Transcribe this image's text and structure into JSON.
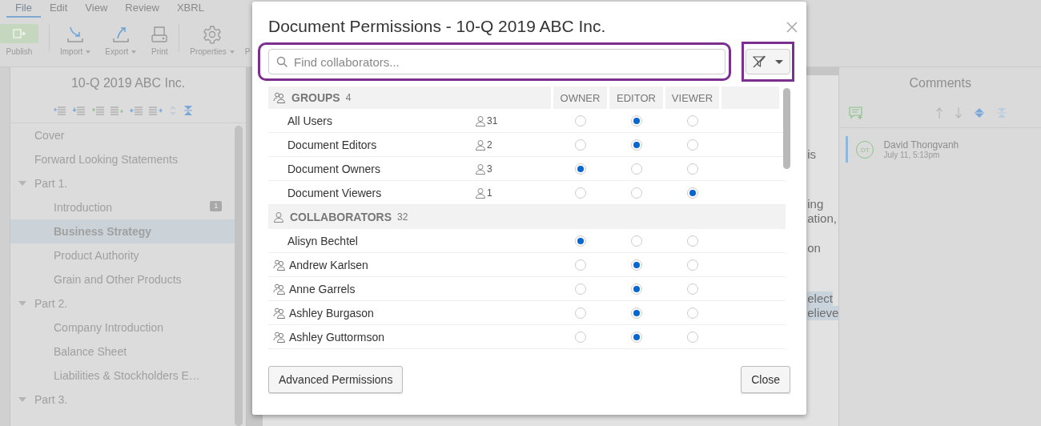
{
  "menu": [
    {
      "label": "File",
      "selected": true
    },
    {
      "label": "Edit",
      "selected": false
    },
    {
      "label": "View",
      "selected": false
    },
    {
      "label": "Review",
      "selected": false
    },
    {
      "label": "XBRL",
      "selected": false
    }
  ],
  "toolbar": [
    {
      "kind": "publish",
      "label": "Publish",
      "dropdown": false
    },
    {
      "kind": "import",
      "label": "Import",
      "dropdown": true
    },
    {
      "kind": "export",
      "label": "Export",
      "dropdown": true
    },
    {
      "kind": "print",
      "label": "Print",
      "dropdown": false
    },
    {
      "kind": "properties",
      "label": "Properties",
      "dropdown": true
    },
    {
      "kind": "cut",
      "label": "P",
      "dropdown": false
    }
  ],
  "outline": {
    "title": "10-Q 2019 ABC Inc.",
    "items": [
      {
        "label": "Cover",
        "selected": false
      },
      {
        "label": "Forward Looking Statements",
        "selected": false
      },
      {
        "label": "Part 1.",
        "selected": false,
        "expanded": true,
        "children": [
          {
            "label": "Introduction",
            "selected": false,
            "comments": "1"
          },
          {
            "label": "Business Strategy",
            "selected": true
          },
          {
            "label": "Product Authority",
            "selected": false
          },
          {
            "label": "Grain and Other Products",
            "selected": false
          }
        ]
      },
      {
        "label": "Part 2.",
        "selected": false,
        "expanded": true,
        "children": [
          {
            "label": "Company Introduction",
            "selected": false
          },
          {
            "label": "Balance Sheet",
            "selected": false
          },
          {
            "label": "Liabilities & Stockholders E…",
            "selected": false
          }
        ]
      },
      {
        "label": "Part 3.",
        "selected": false,
        "expanded": true
      }
    ]
  },
  "document": {
    "fragments": [
      {
        "text": "is",
        "highlighted": false
      },
      {
        "text": "ing",
        "highlighted": false
      },
      {
        "text": "ation,",
        "highlighted": false
      },
      {
        "text": "on",
        "highlighted": false
      },
      {
        "text": "elect",
        "highlighted": true
      },
      {
        "text": "elieve",
        "highlighted": true
      }
    ]
  },
  "comments": {
    "title": "Comments",
    "items": [
      {
        "initials": "DT",
        "author": "David Thongvanh",
        "time": "July 11, 5:13pm"
      }
    ]
  },
  "dialog": {
    "title": "Document Permissions - 10-Q 2019 ABC Inc.",
    "search": {
      "placeholder": "Find collaborators..."
    },
    "columns": [
      "OWNER",
      "EDITOR",
      "VIEWER"
    ],
    "sections": [
      {
        "kind": "groups",
        "label": "GROUPS",
        "count": "4",
        "rows": [
          {
            "name": "All Users",
            "members": "31",
            "roles": [
              {
                "selected": false
              },
              {
                "selected": true
              },
              {
                "selected": false
              }
            ]
          },
          {
            "name": "Document Editors",
            "members": "2",
            "roles": [
              {
                "selected": false
              },
              {
                "selected": true
              },
              {
                "selected": false
              }
            ]
          },
          {
            "name": "Document Owners",
            "members": "3",
            "roles": [
              {
                "selected": true
              },
              {
                "selected": false
              },
              {
                "selected": false
              }
            ]
          },
          {
            "name": "Document Viewers",
            "members": "1",
            "roles": [
              {
                "selected": false
              },
              {
                "selected": false
              },
              {
                "selected": true
              }
            ]
          }
        ]
      },
      {
        "kind": "collaborators",
        "label": "COLLABORATORS",
        "count": "32",
        "rows": [
          {
            "name": "Alisyn Bechtel",
            "via_group": false,
            "roles": [
              {
                "selected": true
              },
              {
                "selected": false
              },
              {
                "selected": false
              }
            ]
          },
          {
            "name": "Andrew Karlsen",
            "via_group": true,
            "roles": [
              {
                "selected": false
              },
              {
                "selected": true
              },
              {
                "selected": false
              }
            ]
          },
          {
            "name": "Anne Garrels",
            "via_group": true,
            "roles": [
              {
                "selected": false
              },
              {
                "selected": true
              },
              {
                "selected": false
              }
            ]
          },
          {
            "name": "Ashley Burgason",
            "via_group": true,
            "roles": [
              {
                "selected": false
              },
              {
                "selected": true
              },
              {
                "selected": false
              }
            ]
          },
          {
            "name": "Ashley Guttormson",
            "via_group": true,
            "roles": [
              {
                "selected": false
              },
              {
                "selected": true
              },
              {
                "selected": false
              }
            ]
          }
        ]
      }
    ],
    "buttons": [
      "Advanced Permissions",
      "Close"
    ]
  }
}
